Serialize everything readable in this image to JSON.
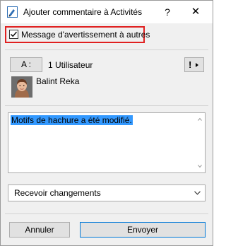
{
  "window": {
    "title": "Ajouter commentaire à Activités",
    "help_label": "?",
    "close_label": "✕"
  },
  "warning": {
    "checked": true,
    "label": "Message d'avertissement à autres"
  },
  "recipients": {
    "to_button_label": "A :",
    "count_label": "1 Utilisateur",
    "priority_icon": "exclamation-dropdown-icon",
    "users": [
      {
        "name": "Balint Reka"
      }
    ]
  },
  "comment": {
    "text": "Motifs de hachure a été modifié."
  },
  "notification": {
    "selected": "Recevoir changements"
  },
  "footer": {
    "cancel_label": "Annuler",
    "send_label": "Envoyer"
  },
  "colors": {
    "highlight": "#e02020",
    "selection": "#3399ff",
    "dialog_bg": "#f0f0f0",
    "default_button_border": "#0078d7"
  }
}
